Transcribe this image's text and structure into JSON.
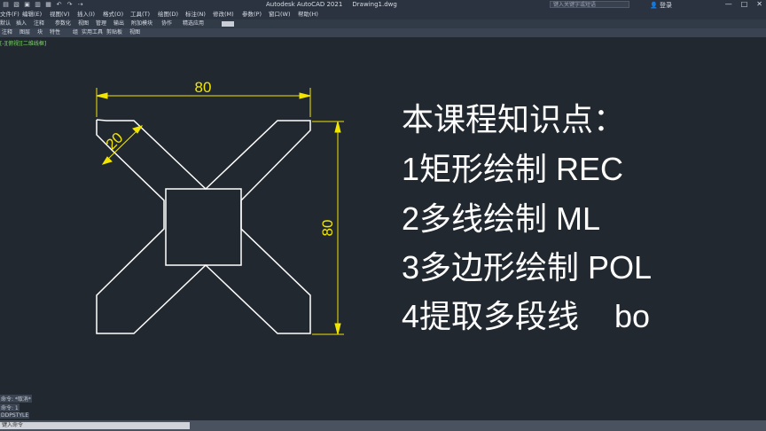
{
  "app": {
    "quick_access_icons": [
      "new-icon",
      "open-icon",
      "save-icon",
      "save-as-icon",
      "plot-icon",
      "undo-icon",
      "redo-icon",
      "share-icon"
    ],
    "title": "Autodesk AutoCAD 2021     Drawing1.dwg",
    "search_placeholder": "键入关键字或短语",
    "login_label": "登录",
    "window_controls": [
      "—",
      "□",
      "✕"
    ]
  },
  "menu": [
    "文件(F)",
    "编辑(E)",
    "视图(V)",
    "插入(I)",
    "格式(O)",
    "工具(T)",
    "绘图(D)",
    "标注(N)",
    "修改(M)",
    "参数(P)",
    "窗口(W)",
    "帮助(H)"
  ],
  "ribbon_tabs": [
    "默认",
    "插入",
    "注释",
    "参数化",
    "视图",
    "管理",
    "输出",
    "附加模块",
    "协作",
    "精选应用"
  ],
  "ribbon_panels": [
    "注释",
    "图层",
    "块",
    "特性",
    "组",
    "实用工具",
    "剪贴板",
    "视图"
  ],
  "viewport_label": "[-][俯视][二维线框]",
  "drawing": {
    "dim_width": "80",
    "dim_height": "80",
    "dim_arm": "20",
    "line_color": "#ffffff",
    "dim_color": "#f2e600"
  },
  "lesson": {
    "heading": "本课程知识点：",
    "items": [
      "1矩形绘制  REC",
      "2多线绘制 ML",
      "3多边形绘制 POL",
      "4提取多段线    bo"
    ]
  },
  "command_history": [
    "命令: *取消*",
    "命令: 1",
    "DDPSTYLE"
  ],
  "command_prompt": "键入命令"
}
